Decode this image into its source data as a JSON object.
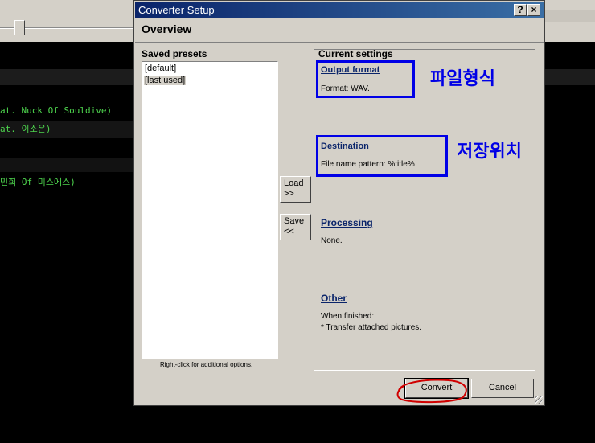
{
  "background": {
    "lines": [
      "at. Nuck Of Souldive)",
      "at. 이소은)",
      "민희 Of 미스에스)"
    ]
  },
  "dialog": {
    "title": "Converter Setup",
    "help_btn": "?",
    "close_btn": "×",
    "heading": "Overview",
    "saved_presets_label": "Saved presets",
    "presets": [
      "[default]",
      "[last used]"
    ],
    "selected_preset": "[last used]",
    "presets_hint": "Right-click for additional options.",
    "load_button": "Load\n>>",
    "save_button": "Save\n<<",
    "current_settings_label": "Current settings",
    "sections": {
      "output": {
        "title": "Output format",
        "text": "Format: WAV."
      },
      "destination": {
        "title": "Destination",
        "text": "File name pattern: %title%"
      },
      "processing": {
        "title": "Processing",
        "text": "None."
      },
      "other": {
        "title": "Other",
        "text1": "When finished:",
        "text2": "* Transfer attached pictures."
      }
    },
    "convert_button": "Convert",
    "cancel_button": "Cancel"
  },
  "annotations": {
    "format_note": "파일형식",
    "location_note": "저장위치",
    "box_color": "#0000e6",
    "circle_color": "#d00000"
  }
}
